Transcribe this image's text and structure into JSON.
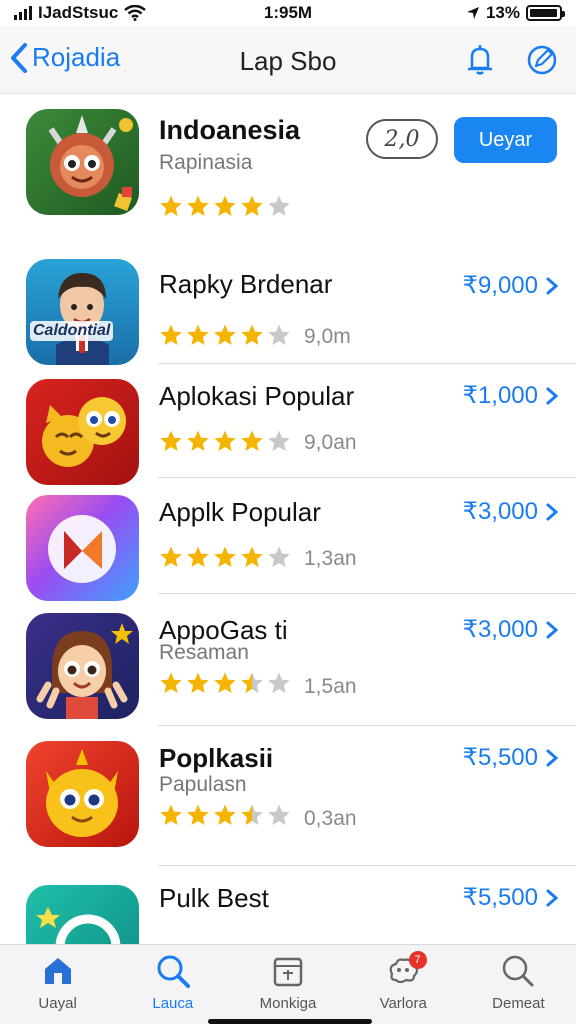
{
  "status_bar": {
    "carrier": "IJadStsuc",
    "time": "1:95M",
    "battery": "13%",
    "battery_level": 0.95
  },
  "nav": {
    "back_label": "Rojadia",
    "title": "Lap Sbo",
    "icons": [
      "notification-bell-icon",
      "compose-icon"
    ]
  },
  "accent_color": "#1a7cf0",
  "star_color": "#f5b400",
  "featured": {
    "name": "Indoanesia",
    "subtitle": "Rapinasia",
    "rating": 4,
    "badge_text": "2,0",
    "action_label": "Ueyar"
  },
  "apps": [
    {
      "name": "Rapky Brdenar",
      "subtitle": "",
      "rating": 4,
      "count": "9,0m",
      "price": "₹9,000",
      "icon_caption": "Caldontial"
    },
    {
      "name": "Aplokasi Popular",
      "subtitle": "",
      "rating": 4,
      "count": "9,0an",
      "price": "₹1,000"
    },
    {
      "name": "Applk Popular",
      "subtitle": "",
      "rating": 4,
      "count": "1,3an",
      "price": "₹3,000"
    },
    {
      "name": "AppoGas ti",
      "subtitle": "Resaman",
      "rating": 3.5,
      "count": "1,5an",
      "price": "₹3,000"
    },
    {
      "name": "Poplkasii",
      "subtitle": "Papulasn",
      "rating": 3.5,
      "count": "0,3an",
      "price": "₹5,500"
    },
    {
      "name": "Pulk Best",
      "subtitle": "",
      "rating": 0,
      "count": "",
      "price": "₹5,500"
    }
  ],
  "tabs": [
    {
      "label": "Uayal",
      "icon": "home-icon",
      "active": false
    },
    {
      "label": "Lauca",
      "icon": "search-icon",
      "active": true
    },
    {
      "label": "Monkiga",
      "icon": "calendar-icon",
      "active": false
    },
    {
      "label": "Varlora",
      "icon": "brain-icon",
      "active": false,
      "badge": "7"
    },
    {
      "label": "Demeat",
      "icon": "search-outline-icon",
      "active": false
    }
  ]
}
